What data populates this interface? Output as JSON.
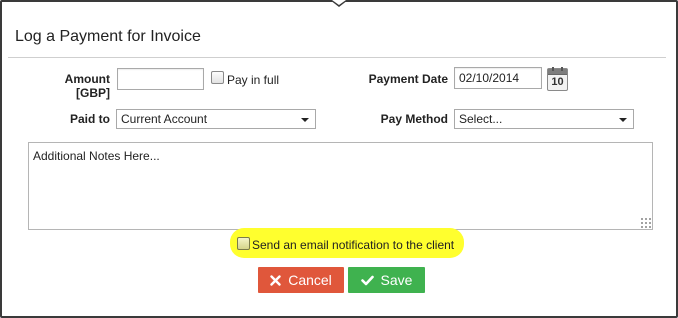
{
  "dialog": {
    "title": "Log a Payment for Invoice"
  },
  "form": {
    "amount_label": "Amount [GBP]",
    "amount_value": "",
    "pay_in_full_label": "Pay in full",
    "pay_in_full_checked": false,
    "payment_date_label": "Payment Date",
    "payment_date_value": "02/10/2014",
    "calendar_day": "10",
    "paid_to_label": "Paid to",
    "paid_to_selected": "Current Account",
    "pay_method_label": "Pay Method",
    "pay_method_selected": "Select...",
    "notes_value": "Additional Notes Here...",
    "email_notification_label": "Send an email notification to the client",
    "email_notification_checked": false
  },
  "buttons": {
    "cancel_label": "Cancel",
    "save_label": "Save"
  },
  "icons": {
    "calendar": "calendar-icon",
    "cancel": "close-icon",
    "save": "checkmark-icon"
  },
  "colors": {
    "cancel_button": "#e0573b",
    "save_button": "#3fb24f",
    "highlight": "#ffff2e"
  }
}
